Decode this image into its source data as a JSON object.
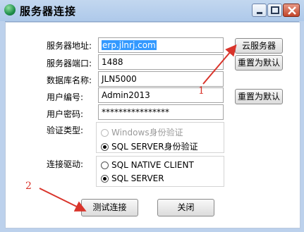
{
  "window": {
    "title": "服务器连接",
    "icon": "globe-icon",
    "controls": [
      "minimize-icon",
      "maximize-icon",
      "close-icon"
    ]
  },
  "form": {
    "server_address_label": "服务器地址:",
    "server_address_value": "erp.jlnrj.com",
    "server_port_label": "服务器端口:",
    "server_port_value": "1488",
    "database_name_label": "数据库名称:",
    "database_name_value": "JLN5000",
    "user_id_label": "用户编号:",
    "user_id_value": "Admin2013",
    "user_password_label": "用户密码:",
    "user_password_value": "****************",
    "auth_type_label": "验证类型:",
    "auth_options": [
      {
        "label": "Windows身份验证",
        "checked": false,
        "disabled": true
      },
      {
        "label": "SQL SERVER身份验证",
        "checked": true,
        "disabled": false
      }
    ],
    "driver_label": "连接驱动:",
    "driver_options": [
      {
        "label": "SQL NATIVE CLIENT",
        "checked": false
      },
      {
        "label": "SQL SERVER",
        "checked": true
      }
    ]
  },
  "buttons": {
    "cloud_server": "云服务器",
    "reset_default_1": "重置为默认",
    "reset_default_2": "重置为默认",
    "test_connection": "测试连接",
    "close": "关闭"
  },
  "annotations": {
    "marker_1": "1",
    "marker_2": "2",
    "color": "#d9342b"
  }
}
